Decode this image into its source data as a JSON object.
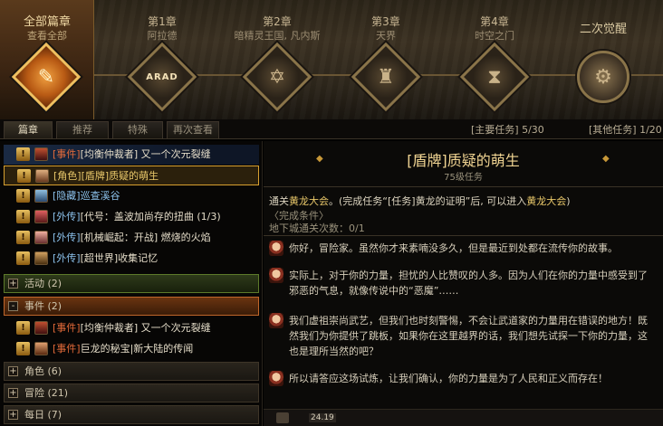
{
  "chapters": {
    "all": {
      "title": "全部篇章",
      "sub": "查看全部"
    },
    "items": [
      {
        "title": "第1章",
        "sub": "阿拉德",
        "icon": "arad-emblem-icon",
        "emblem_text": "ARAD"
      },
      {
        "title": "第2章",
        "sub": "暗精灵王国, 凡内斯",
        "icon": "star-emblem-icon"
      },
      {
        "title": "第3章",
        "sub": "天界",
        "icon": "castle-emblem-icon"
      },
      {
        "title": "第4章",
        "sub": "时空之门",
        "icon": "hourglass-emblem-icon"
      },
      {
        "title": "二次觉醒",
        "sub": "",
        "icon": "gear-emblem-icon"
      }
    ]
  },
  "tabs": [
    "篇章",
    "推荐",
    "特殊",
    "再次查看"
  ],
  "main_quest": {
    "label": "[主要任务]",
    "value": "5/30"
  },
  "other_quest": {
    "label": "[其他任务]",
    "value": "1/20"
  },
  "list": {
    "rows": [
      {
        "cat": "[事件]",
        "text": "[均衡仲裁者] 又一个次元裂缝",
        "cat_color": "red"
      },
      {
        "cat": "[角色]",
        "text": "[盾牌]质疑的萌生",
        "cat_color": "red",
        "selected": true
      },
      {
        "cat": "[隐藏]",
        "text": "巡查溪谷",
        "cat_color": "blue"
      },
      {
        "cat": "[外传]",
        "text": "[代号：盖波加尚存的扭曲 (1/3)",
        "cat_color": "blue"
      },
      {
        "cat": "[外传]",
        "text": "[机械崛起：开战] 燃烧的火焰",
        "cat_color": "blue"
      },
      {
        "cat": "[外传]",
        "text": "[超世界]收集记忆",
        "cat_color": "blue"
      }
    ],
    "groups": [
      {
        "label": "活动",
        "count": "(2)",
        "state": "+"
      },
      {
        "label": "事件",
        "count": "(2)",
        "state": "-"
      },
      {
        "label": "角色",
        "count": "(6)",
        "state": "+"
      },
      {
        "label": "冒险",
        "count": "(21)",
        "state": "+"
      },
      {
        "label": "每日",
        "count": "(7)",
        "state": "+"
      }
    ],
    "event_rows": [
      {
        "cat": "[事件]",
        "text": "[均衡仲裁者] 又一个次元裂缝"
      },
      {
        "cat": "[事件]",
        "text": "巨龙的秘宝|新大陆的传闻"
      }
    ]
  },
  "detail": {
    "title": "[盾牌]质疑的萌生",
    "level": "75级任务",
    "goal_prefix": "通关",
    "goal_place": "黄龙大会",
    "goal_mid": "。(完成任务“[任务]黄龙的证明”后, 可以进入",
    "goal_place2": "黄龙大会",
    "goal_end": ")",
    "cond_label": "〈完成条件〉",
    "cond_value": "地下城通关次数：0/1",
    "dialogs": [
      "你好，冒险家。虽然你才来素喃没多久，但是最近到处都在流传你的故事。",
      "实际上，对于你的力量，担忧的人比赞叹的人多。因为人们在你的力量中感受到了邪恶的气息，就像传说中的“恶魔”……",
      "我们虚祖崇尚武艺，但我们也时刻警惕，不会让武道家的力量用在错误的地方！既然我们为你提供了跳板，如果你在这里越界的话，我们想先试探一下你的力量，这也是理所当然的吧？",
      "所以请答应这场试炼，让我们确认，你的力量是为了人民和正义而存在！"
    ],
    "bottom_stamp": "24.19"
  },
  "colors": {
    "accent": "#e9c86a",
    "selected_border": "#d8a030",
    "event_red": "#e66b3a"
  }
}
